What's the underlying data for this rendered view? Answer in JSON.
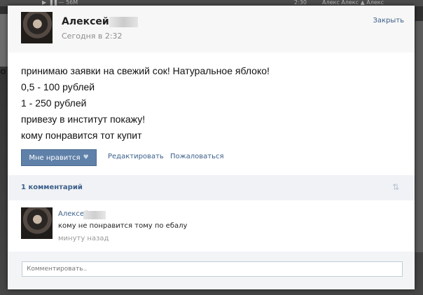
{
  "background": {
    "top_strip_left": "▶  ▐▐ — 56М",
    "top_strip_time": "2:30",
    "top_strip_right": "Алекс      Алекс      ▲   Алекс",
    "left_glyph": "о"
  },
  "post": {
    "author": "Алексей",
    "time": "Сегодня в 2:32",
    "close_label": "Закрыть",
    "lines": [
      "принимаю заявки на свежий сок! Натуральное яблоко!",
      "0,5 - 100 рублей",
      "1 - 250 рублей",
      "привезу в институт покажу!",
      "кому понравится тот купит"
    ],
    "like_label": "Мне нравится",
    "edit_label": "Редактировать",
    "report_label": "Пожаловаться"
  },
  "comments": {
    "count_label": "1 комментарий",
    "items": [
      {
        "author": "Алексей",
        "text": "кому не понравится тому по ебалу",
        "time": "минуту назад"
      }
    ],
    "input_placeholder": "Комментировать.."
  },
  "icons": {
    "heart": "heart-icon",
    "sort": "sort-arrows-icon"
  },
  "colors": {
    "link": "#3b5f8a",
    "like_button": "#5f80a8",
    "backdrop": "#3a3a3a"
  }
}
